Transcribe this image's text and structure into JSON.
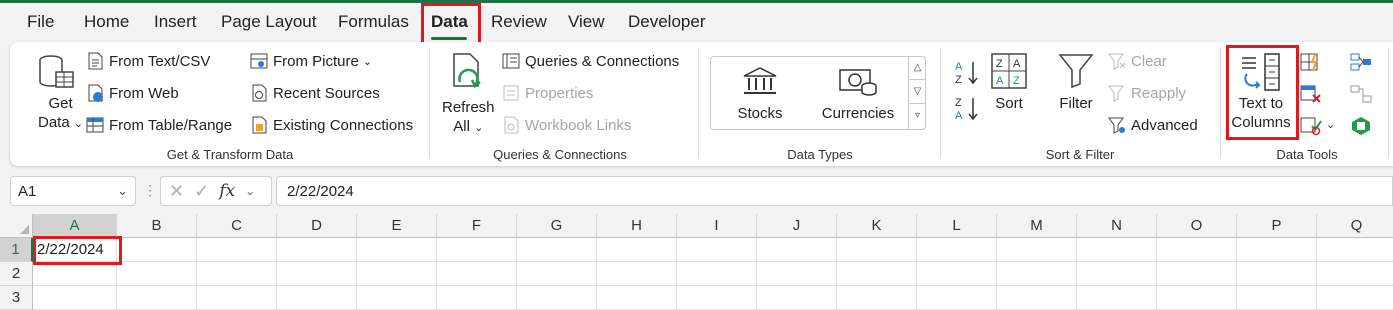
{
  "tabs": [
    "File",
    "Home",
    "Insert",
    "Page Layout",
    "Formulas",
    "Data",
    "Review",
    "View",
    "Developer"
  ],
  "active_tab": "Data",
  "colors": {
    "accent": "#1e7145",
    "highlight": "#e0191f"
  },
  "get_transform": {
    "get_data_line1": "Get",
    "get_data_line2": "Data",
    "from_text_csv": "From Text/CSV",
    "from_web": "From Web",
    "from_table_range": "From Table/Range",
    "from_picture": "From Picture",
    "recent_sources": "Recent Sources",
    "existing_connections": "Existing Connections",
    "label": "Get & Transform Data"
  },
  "queries": {
    "refresh_line1": "Refresh",
    "refresh_line2": "All",
    "queries_connections": "Queries & Connections",
    "properties": "Properties",
    "workbook_links": "Workbook Links",
    "label": "Queries & Connections"
  },
  "data_types": {
    "stocks": "Stocks",
    "currencies": "Currencies",
    "label": "Data Types"
  },
  "sort_filter": {
    "sort": "Sort",
    "filter": "Filter",
    "clear": "Clear",
    "reapply": "Reapply",
    "advanced": "Advanced",
    "label": "Sort & Filter"
  },
  "data_tools": {
    "text_to_line1": "Text to",
    "text_to_line2": "Columns",
    "label": "Data Tools"
  },
  "formula_bar": {
    "name_box": "A1",
    "fx": "fx",
    "value": "2/22/2024"
  },
  "grid": {
    "columns": [
      "A",
      "B",
      "C",
      "D",
      "E",
      "F",
      "G",
      "H",
      "I",
      "J",
      "K",
      "L",
      "M",
      "N",
      "O",
      "P",
      "Q"
    ],
    "rows": [
      "1",
      "2",
      "3"
    ],
    "a1_value": "2/22/2024"
  }
}
